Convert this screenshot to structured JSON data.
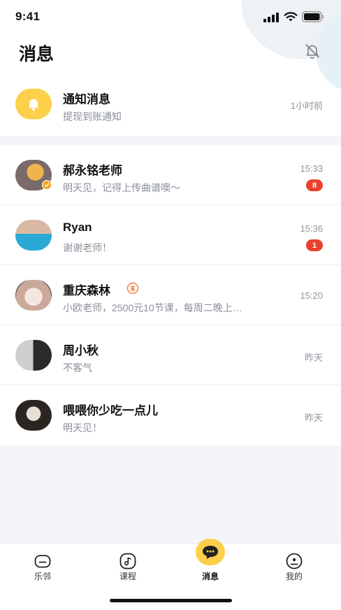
{
  "status_bar": {
    "time": "9:41"
  },
  "header": {
    "title": "消息"
  },
  "notice": {
    "title": "通知消息",
    "subtitle": "提现到账通知",
    "time": "1小时前"
  },
  "chats": [
    {
      "name": "郝永铭老师",
      "message": "明天见，记得上传曲谱噢～",
      "time": "15:33",
      "unread": "8",
      "verified": true,
      "avatar_colors": [
        "#7a6a6a",
        "#f0b44c"
      ]
    },
    {
      "name": "Ryan",
      "message": "谢谢老师！",
      "time": "15:36",
      "unread": "1",
      "verified": false,
      "avatar_colors": [
        "#d9b9a4",
        "#2aa9d6"
      ]
    },
    {
      "name": "重庆森林",
      "message": "小欧老师，2500元10节课，每周二晚上…",
      "time": "15:20",
      "unread": "",
      "verified": false,
      "avatar_colors": [
        "#caa99a",
        "#f4e6df"
      ]
    },
    {
      "name": "周小秋",
      "message": "不客气",
      "time": "昨天",
      "unread": "",
      "verified": false,
      "avatar_colors": [
        "#cfcfcf",
        "#2a2a2a"
      ]
    },
    {
      "name": "喂喂你少吃一点儿",
      "message": "明天见！",
      "time": "昨天",
      "unread": "",
      "verified": false,
      "avatar_colors": [
        "#e8dfd6",
        "#2b2522"
      ]
    }
  ],
  "tabs": [
    {
      "label": "乐邻",
      "icon": "home-icon"
    },
    {
      "label": "课程",
      "icon": "music-note-icon"
    },
    {
      "label": "消息",
      "icon": "chat-bubble-icon",
      "active": true
    },
    {
      "label": "我的",
      "icon": "profile-icon"
    }
  ],
  "colors": {
    "accent": "#fcd04b",
    "badge": "#e8412d",
    "tag": "#f07a3c"
  }
}
